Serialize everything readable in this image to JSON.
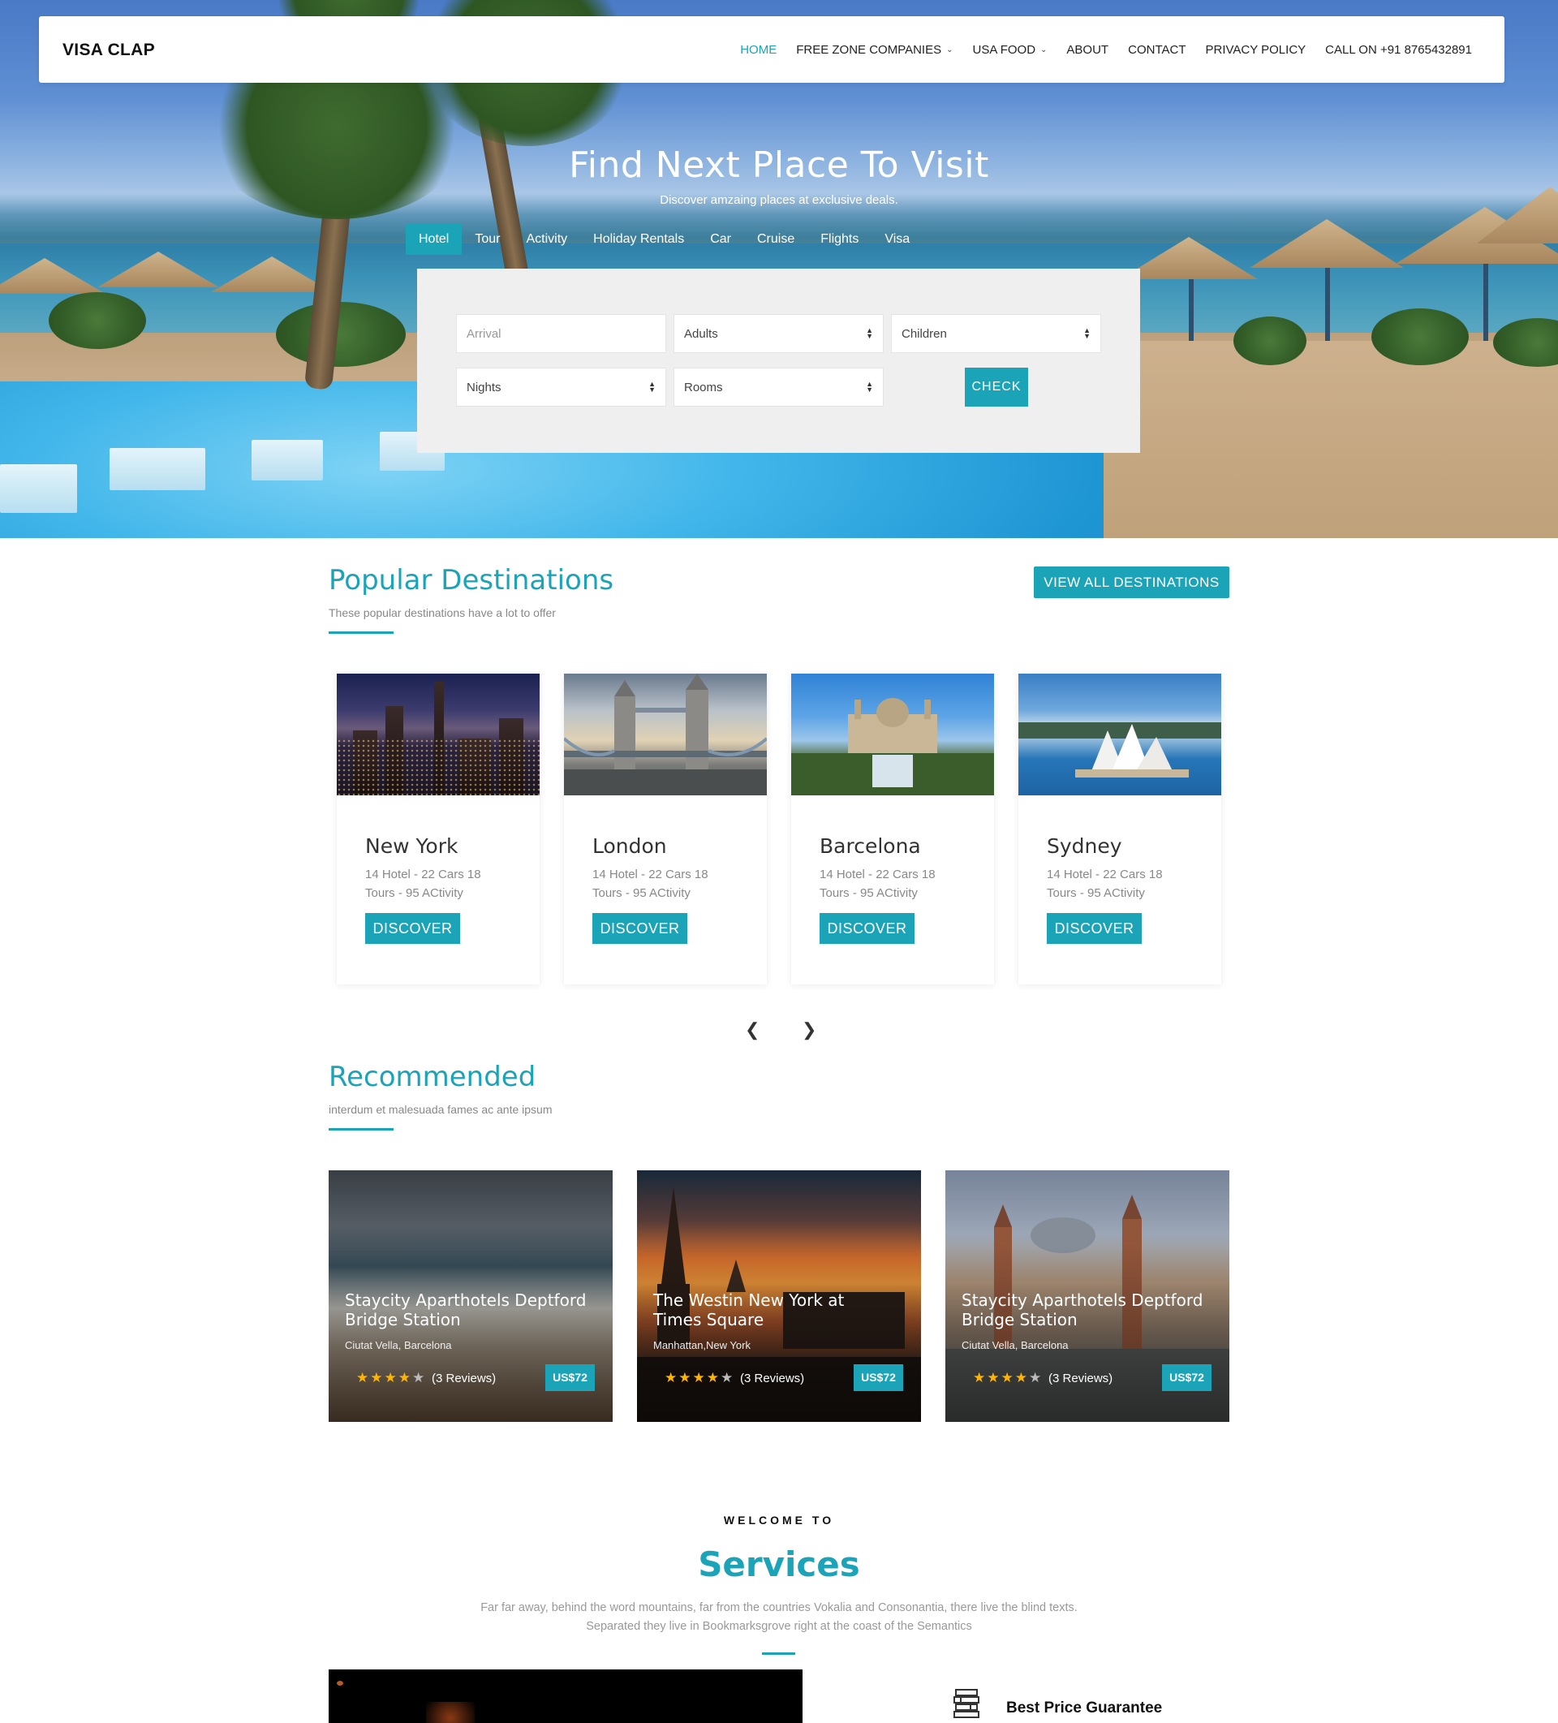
{
  "brand": "VISA CLAP",
  "nav": {
    "items": [
      {
        "label": "HOME",
        "active": true,
        "dropdown": false
      },
      {
        "label": "FREE ZONE COMPANIES",
        "active": false,
        "dropdown": true
      },
      {
        "label": "USA FOOD",
        "active": false,
        "dropdown": true
      },
      {
        "label": "ABOUT",
        "active": false,
        "dropdown": false
      },
      {
        "label": "CONTACT",
        "active": false,
        "dropdown": false
      },
      {
        "label": "PRIVACY POLICY",
        "active": false,
        "dropdown": false
      },
      {
        "label": "CALL ON +91 8765432891",
        "active": false,
        "dropdown": false
      }
    ]
  },
  "hero": {
    "title": "Find Next Place To Visit",
    "subtitle": "Discover amzaing places at exclusive deals.",
    "tabs": [
      "Hotel",
      "Tour",
      "Activity",
      "Holiday Rentals",
      "Car",
      "Cruise",
      "Flights",
      "Visa"
    ],
    "active_tab": "Hotel"
  },
  "search": {
    "arrival_placeholder": "Arrival",
    "adults": "Adults",
    "children": "Children",
    "nights": "Nights",
    "rooms": "Rooms",
    "check_label": "CHECK"
  },
  "popular": {
    "title": "Popular Destinations",
    "subtitle": "These popular destinations have a lot to offer",
    "view_all_label": "VIEW ALL DESTINATIONS",
    "cards": [
      {
        "name": "New York",
        "line1": "14 Hotel - 22 Cars 18",
        "line2": "Tours - 95 ACtivity",
        "button": "DISCOVER"
      },
      {
        "name": "London",
        "line1": "14 Hotel - 22 Cars 18",
        "line2": "Tours - 95 ACtivity",
        "button": "DISCOVER"
      },
      {
        "name": "Barcelona",
        "line1": "14 Hotel - 22 Cars 18",
        "line2": "Tours - 95 ACtivity",
        "button": "DISCOVER"
      },
      {
        "name": "Sydney",
        "line1": "14 Hotel - 22 Cars 18",
        "line2": "Tours - 95 ACtivity",
        "button": "DISCOVER"
      }
    ]
  },
  "recommended": {
    "title": "Recommended",
    "subtitle": "interdum et malesuada fames ac ante ipsum",
    "cards": [
      {
        "title": "Staycity Aparthotels Deptford Bridge Station",
        "location": "Ciutat Vella, Barcelona",
        "rating": 4,
        "reviews": "(3 Reviews)",
        "price": "US$72"
      },
      {
        "title": "The Westin New York at Times Square",
        "location": "Manhattan,New York",
        "rating": 4,
        "reviews": "(3 Reviews)",
        "price": "US$72"
      },
      {
        "title": "Staycity Aparthotels Deptford Bridge Station",
        "location": "Ciutat Vella, Barcelona",
        "rating": 4,
        "reviews": "(3 Reviews)",
        "price": "US$72"
      }
    ]
  },
  "services": {
    "eyebrow": "WELCOME TO",
    "title": "Services",
    "text": "Far far away, behind the word mountains, far from the countries Vokalia and Consonantia, there live the blind texts. Separated they live in Bookmarksgrove right at the coast of the Semantics",
    "feature_title": "Best Price Guarantee"
  },
  "colors": {
    "accent": "#1ba4b8"
  }
}
